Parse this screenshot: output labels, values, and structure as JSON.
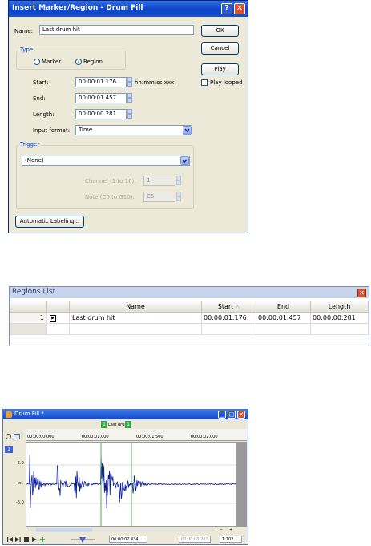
{
  "dialog": {
    "title": "Insert Marker/Region - Drum Fill",
    "help_glyph": "?",
    "close_glyph": "✕",
    "name_label": "Name:",
    "name_value": "Last drum hit",
    "type_group": "Type",
    "marker_label": "Marker",
    "region_label": "Region",
    "selected_type": "Region",
    "start_label": "Start:",
    "start_value": "00:00:01.176",
    "time_hint": "hh:mm:ss.xxx",
    "end_label": "End:",
    "end_value": "00:00:01.457",
    "length_label": "Length:",
    "length_value": "00:00:00.281",
    "input_format_label": "Input format:",
    "input_format_value": "Time",
    "trigger_group": "Trigger",
    "trigger_value": "(None)",
    "channel_label": "Channel (1 to 16):",
    "channel_value": "1",
    "note_label": "Note (C0 to G10):",
    "note_value": "C5",
    "auto_label_button": "Automatic Labeling...",
    "ok_button": "OK",
    "cancel_button": "Cancel",
    "play_button": "Play",
    "play_looped_label": "Play looped",
    "play_looped_checked": false
  },
  "regions_list": {
    "title": "Regions List",
    "close_glyph": "✕",
    "columns": [
      "",
      "",
      "Name",
      "Start",
      "End",
      "Length"
    ],
    "sort_indicator": "△",
    "rows": [
      {
        "index": "1",
        "play_glyph": "▶",
        "name": "Last drum hit",
        "start": "00:00:01.176",
        "end": "00:00:01.457",
        "length": "00:00:00.281"
      }
    ]
  },
  "drum_window": {
    "title": "Drum Fill *",
    "min_glyph": "_",
    "max_glyph": "□",
    "close_glyph": "✕",
    "region_label": "Last drum",
    "region_start_tag": "1",
    "region_end_tag": "1",
    "ruler_ticks": [
      "00:00:00.000",
      "00:00:01.000",
      "00:00:01.500",
      "00:00:02.000"
    ],
    "db_labels": [
      "-6.0",
      "-Inf.",
      "-6.0"
    ],
    "channel_badge": "1",
    "zoom_minus": "−",
    "zoom_plus": "+",
    "position": "00:00:02.434",
    "selection_length": "00:00:00.281",
    "zoom_ratio": "1:102"
  },
  "colors": {
    "waveform": "#0a1e9e",
    "marker_line": "#3aa64a",
    "region_tag": "#3aa64a",
    "title_blue": "#0c44c8"
  }
}
